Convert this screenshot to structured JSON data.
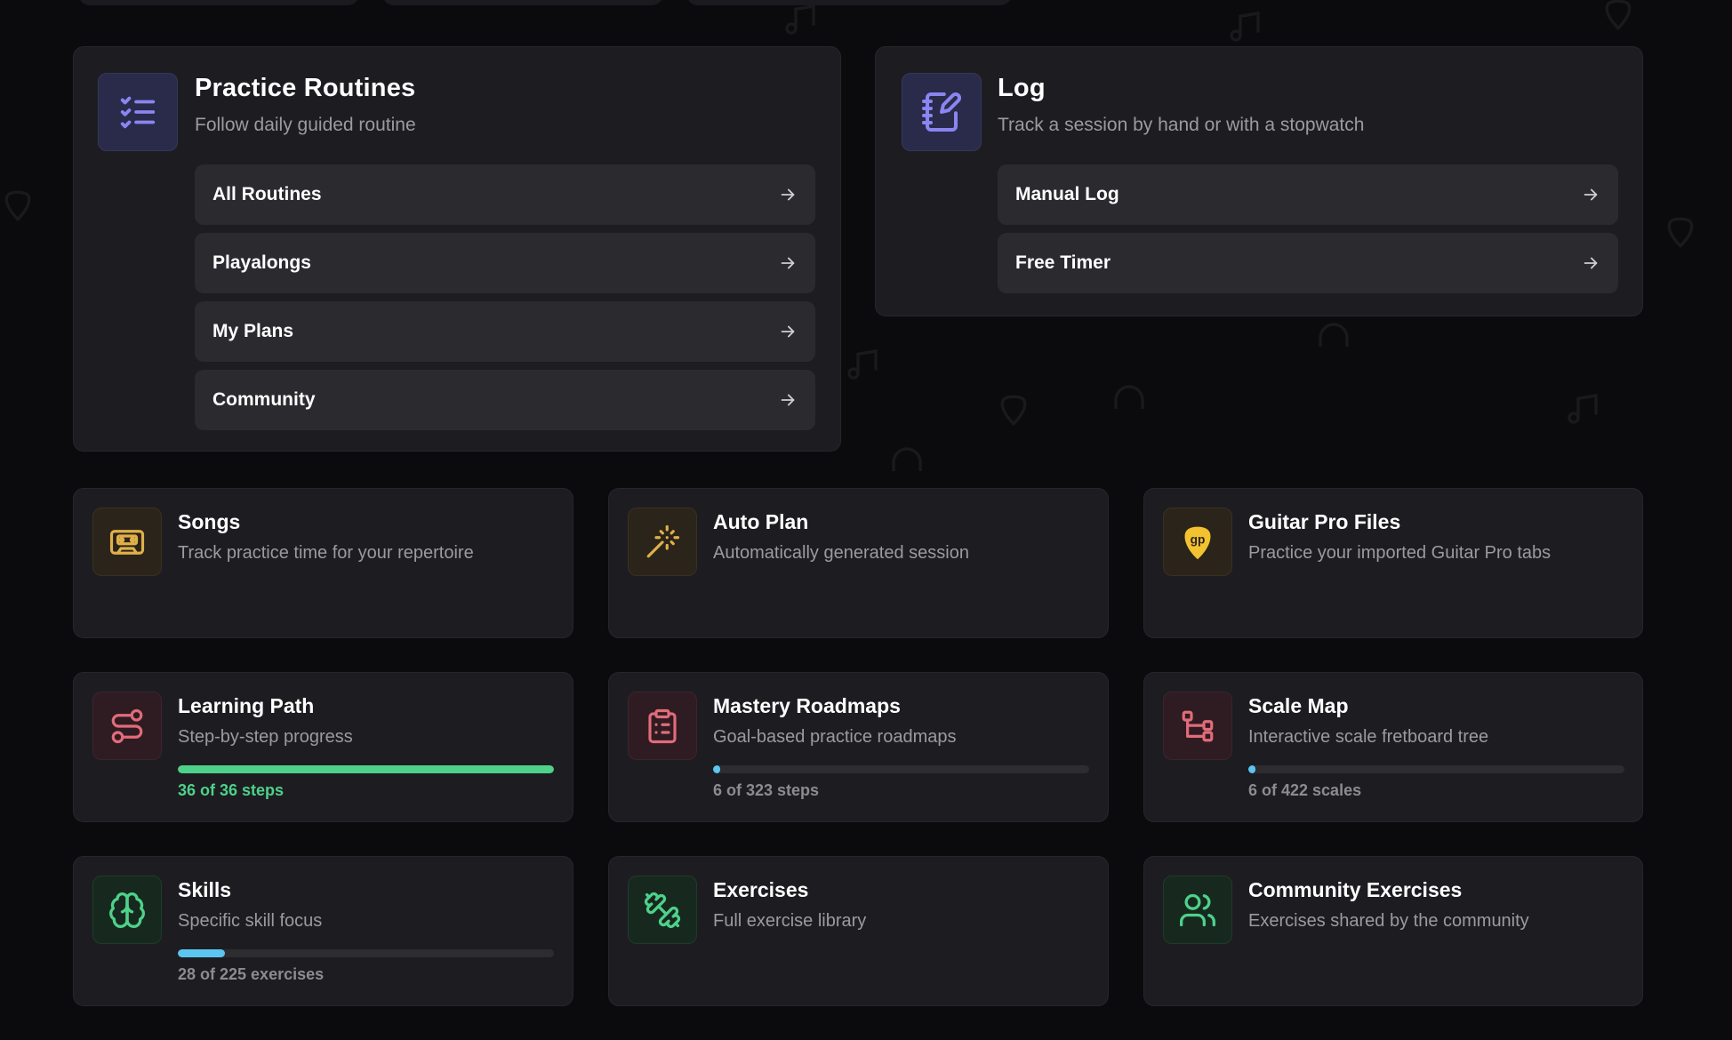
{
  "routines": {
    "title": "Practice Routines",
    "subtitle": "Follow daily guided routine",
    "icon": "checklist-icon",
    "links": [
      {
        "label": "All Routines"
      },
      {
        "label": "Playalongs"
      },
      {
        "label": "My Plans"
      },
      {
        "label": "Community"
      }
    ]
  },
  "log": {
    "title": "Log",
    "subtitle": "Track a session by hand or with a stopwatch",
    "icon": "notebook-pen-icon",
    "links": [
      {
        "label": "Manual Log"
      },
      {
        "label": "Free Timer"
      }
    ]
  },
  "tiles": {
    "songs": {
      "title": "Songs",
      "subtitle": "Track practice time for your repertoire",
      "icon": "cassette-icon",
      "color": "#e0b04a"
    },
    "auto_plan": {
      "title": "Auto Plan",
      "subtitle": "Automatically generated session",
      "icon": "magic-wand-icon",
      "color": "#e0b04a"
    },
    "guitar_pro": {
      "title": "Guitar Pro Files",
      "subtitle": "Practice your imported Guitar Pro tabs",
      "icon": "guitar-pick-icon",
      "badge": "gp",
      "color": "#f2c230"
    },
    "learning_path": {
      "title": "Learning Path",
      "subtitle": "Step-by-step progress",
      "icon": "route-icon",
      "color": "#e36b7a",
      "progress": 1.0,
      "progress_text": "36 of 36 steps",
      "progress_color": "#4ed18a"
    },
    "mastery": {
      "title": "Mastery Roadmaps",
      "subtitle": "Goal-based practice roadmaps",
      "icon": "clipboard-list-icon",
      "color": "#e36b7a",
      "progress": 0.0186,
      "progress_text": "6 of 323 steps",
      "progress_color": "#5bc6f0"
    },
    "scale_map": {
      "title": "Scale Map",
      "subtitle": "Interactive scale fretboard tree",
      "icon": "tree-icon",
      "color": "#e36b7a",
      "progress": 0.0142,
      "progress_text": "6 of 422 scales",
      "progress_color": "#5bc6f0"
    },
    "skills": {
      "title": "Skills",
      "subtitle": "Specific skill focus",
      "icon": "brain-icon",
      "color": "#4ed18a",
      "progress": 0.1244,
      "progress_text": "28 of 225 exercises",
      "progress_color": "#5bc6f0"
    },
    "exercises": {
      "title": "Exercises",
      "subtitle": "Full exercise library",
      "icon": "dumbbell-icon",
      "color": "#4ed18a"
    },
    "community_exercises": {
      "title": "Community Exercises",
      "subtitle": "Exercises shared by the community",
      "icon": "users-icon",
      "color": "#4ed18a"
    }
  },
  "colors": {
    "background": "#0b0b0d",
    "card": "#1d1d21",
    "row": "#2a2a2f",
    "accent_purple": "#8a85f0",
    "success_green": "#4ed18a",
    "info_blue": "#5bc6f0"
  }
}
